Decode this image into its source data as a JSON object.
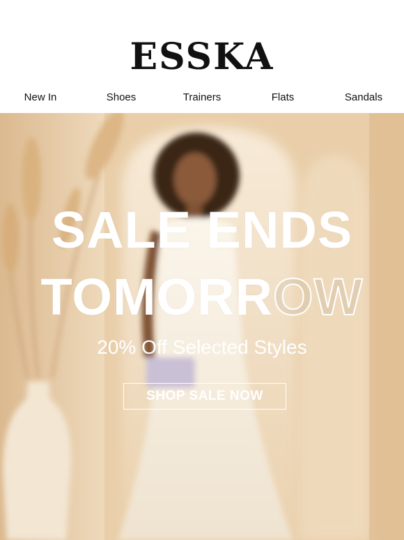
{
  "brand": {
    "logo_text": "ESSKA"
  },
  "nav": {
    "items": [
      {
        "label": "New In"
      },
      {
        "label": "Shoes"
      },
      {
        "label": "Trainers"
      },
      {
        "label": "Flats"
      },
      {
        "label": "Sandals"
      }
    ]
  },
  "hero": {
    "headline_line1": "SALE ENDS",
    "headline_line2_solid": "TOMORR",
    "headline_line2_outline": "OW",
    "subheadline": "20% Off Selected Styles",
    "cta_label": "SHOP SALE NOW",
    "image_subject": "model-in-white-dress-with-pampas-grass"
  },
  "colors": {
    "background": "#ffffff",
    "text": "#111111",
    "hero_text": "#ffffff",
    "hero_tone": "#e8cba3"
  }
}
